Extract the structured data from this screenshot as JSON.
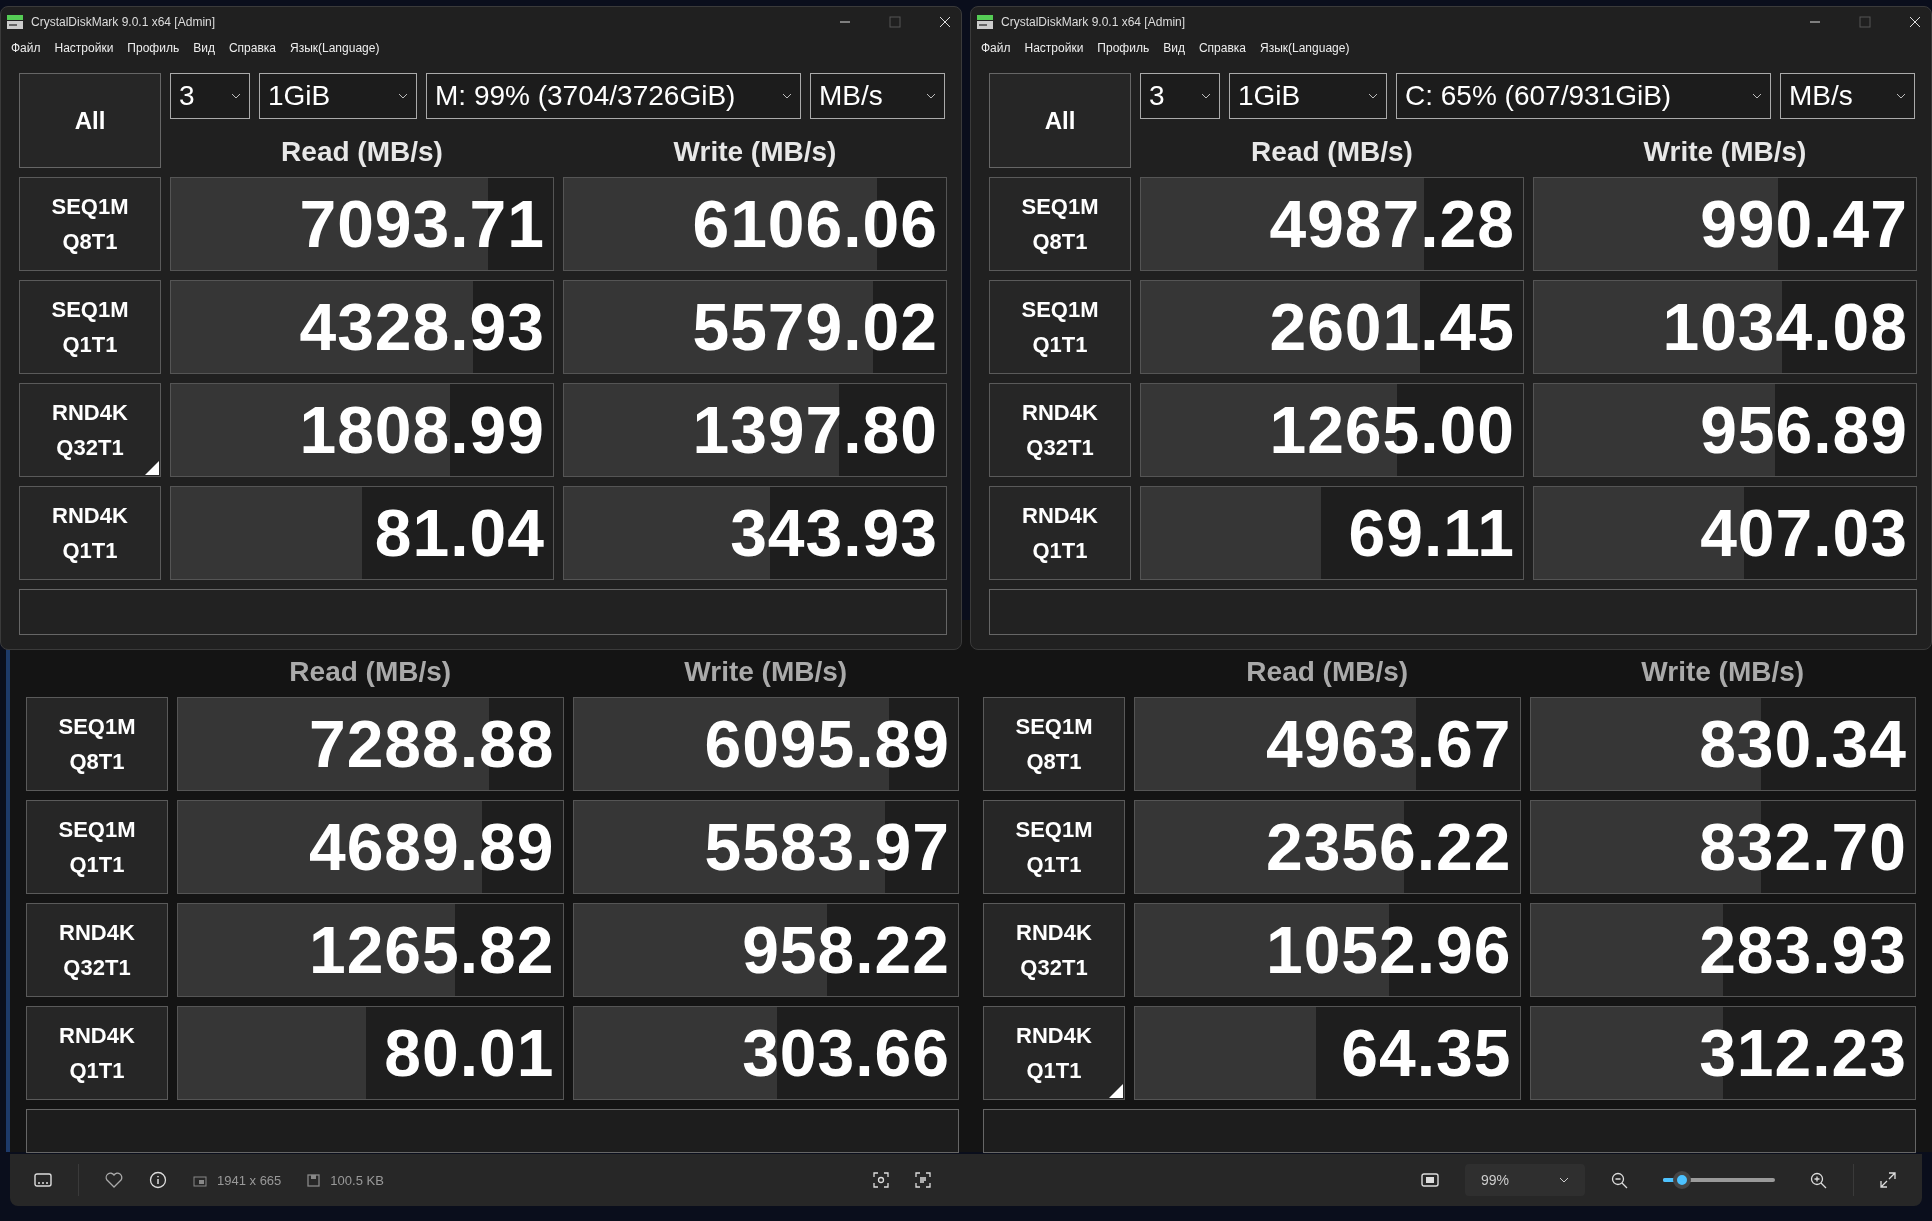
{
  "windows": [
    {
      "title": "CrystalDiskMark 9.0.1 x64 [Admin]",
      "menu": [
        "Файл",
        "Настройки",
        "Профиль",
        "Вид",
        "Справка",
        "Язык(Language)"
      ],
      "all_label": "All",
      "count": "3",
      "size": "1GiB",
      "drive": "M: 99% (3704/3726GiB)",
      "unit": "MB/s",
      "read_header": "Read (MB/s)",
      "write_header": "Write (MB/s)",
      "tests": [
        {
          "label": [
            "SEQ1M",
            "Q8T1"
          ],
          "marked": false,
          "read": {
            "value": "7093.71",
            "level": 0.83
          },
          "write": {
            "value": "6106.06",
            "level": 0.82
          }
        },
        {
          "label": [
            "SEQ1M",
            "Q1T1"
          ],
          "marked": false,
          "read": {
            "value": "4328.93",
            "level": 0.79
          },
          "write": {
            "value": "5579.02",
            "level": 0.81
          }
        },
        {
          "label": [
            "RND4K",
            "Q32T1"
          ],
          "marked": true,
          "read": {
            "value": "1808.99",
            "level": 0.73
          },
          "write": {
            "value": "1397.80",
            "level": 0.72
          }
        },
        {
          "label": [
            "RND4K",
            "Q1T1"
          ],
          "marked": false,
          "read": {
            "value": "81.04",
            "level": 0.5
          },
          "write": {
            "value": "343.93",
            "level": 0.54
          }
        }
      ]
    },
    {
      "title": "CrystalDiskMark 9.0.1 x64 [Admin]",
      "menu": [
        "Файл",
        "Настройки",
        "Профиль",
        "Вид",
        "Справка",
        "Язык(Language)"
      ],
      "all_label": "All",
      "count": "3",
      "size": "1GiB",
      "drive": "C: 65% (607/931GiB)",
      "unit": "MB/s",
      "read_header": "Read (MB/s)",
      "write_header": "Write (MB/s)",
      "tests": [
        {
          "label": [
            "SEQ1M",
            "Q8T1"
          ],
          "marked": false,
          "read": {
            "value": "4987.28",
            "level": 0.74
          },
          "write": {
            "value": "990.47",
            "level": 0.64
          }
        },
        {
          "label": [
            "SEQ1M",
            "Q1T1"
          ],
          "marked": false,
          "read": {
            "value": "2601.45",
            "level": 0.73
          },
          "write": {
            "value": "1034.08",
            "level": 0.65
          }
        },
        {
          "label": [
            "RND4K",
            "Q32T1"
          ],
          "marked": false,
          "read": {
            "value": "1265.00",
            "level": 0.67
          },
          "write": {
            "value": "956.89",
            "level": 0.63
          }
        },
        {
          "label": [
            "RND4K",
            "Q1T1"
          ],
          "marked": false,
          "read": {
            "value": "69.11",
            "level": 0.47
          },
          "write": {
            "value": "407.03",
            "level": 0.55
          }
        }
      ]
    }
  ],
  "image_panels": [
    {
      "read_header": "Read (MB/s)",
      "write_header": "Write (MB/s)",
      "tests": [
        {
          "label": [
            "SEQ1M",
            "Q8T1"
          ],
          "marked": false,
          "read": {
            "value": "7288.88",
            "level": 0.81
          },
          "write": {
            "value": "6095.89",
            "level": 0.82
          }
        },
        {
          "label": [
            "SEQ1M",
            "Q1T1"
          ],
          "marked": false,
          "read": {
            "value": "4689.89",
            "level": 0.79
          },
          "write": {
            "value": "5583.97",
            "level": 0.81
          }
        },
        {
          "label": [
            "RND4K",
            "Q32T1"
          ],
          "marked": false,
          "read": {
            "value": "1265.82",
            "level": 0.72
          },
          "write": {
            "value": "958.22",
            "level": 0.66
          }
        },
        {
          "label": [
            "RND4K",
            "Q1T1"
          ],
          "marked": false,
          "read": {
            "value": "80.01",
            "level": 0.49
          },
          "write": {
            "value": "303.66",
            "level": 0.53
          }
        }
      ]
    },
    {
      "read_header": "Read (MB/s)",
      "write_header": "Write (MB/s)",
      "tests": [
        {
          "label": [
            "SEQ1M",
            "Q8T1"
          ],
          "marked": false,
          "read": {
            "value": "4963.67",
            "level": 0.73
          },
          "write": {
            "value": "830.34",
            "level": 0.6
          }
        },
        {
          "label": [
            "SEQ1M",
            "Q1T1"
          ],
          "marked": false,
          "read": {
            "value": "2356.22",
            "level": 0.7
          },
          "write": {
            "value": "832.70",
            "level": 0.6
          }
        },
        {
          "label": [
            "RND4K",
            "Q32T1"
          ],
          "marked": false,
          "read": {
            "value": "1052.96",
            "level": 0.66
          },
          "write": {
            "value": "283.93",
            "level": 0.5
          }
        },
        {
          "label": [
            "RND4K",
            "Q1T1"
          ],
          "marked": true,
          "read": {
            "value": "64.35",
            "level": 0.47
          },
          "write": {
            "value": "312.23",
            "level": 0.5
          }
        }
      ]
    }
  ],
  "toolbar": {
    "dimensions": "1941 x 665",
    "file_size": "100.5 KB",
    "zoom": "99%",
    "zoom_slider": {
      "level": 0.17
    }
  }
}
